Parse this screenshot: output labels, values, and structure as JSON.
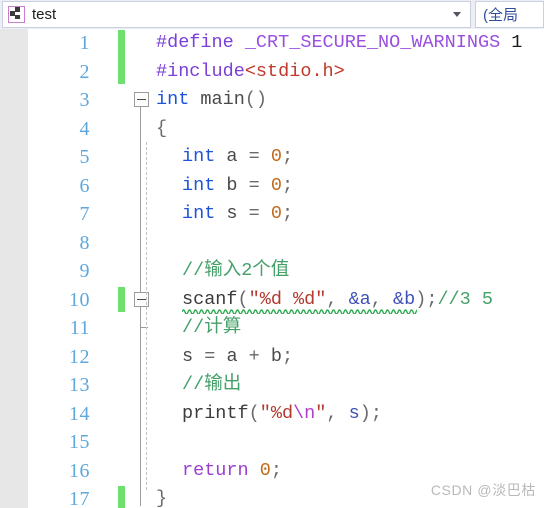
{
  "window": {
    "navbar": {
      "project_icon": "cpp-project-icon",
      "project_name": "test",
      "scope_dropdown_arrow": "chevron-down-icon",
      "member_value": "(全局"
    }
  },
  "editor": {
    "gutter": {
      "line_numbers": [
        "1",
        "2",
        "3",
        "4",
        "5",
        "6",
        "7",
        "8",
        "9",
        "10",
        "11",
        "12",
        "13",
        "14",
        "15",
        "16",
        "17"
      ]
    },
    "change_bar_lines": [
      1,
      2,
      10,
      17
    ],
    "collapse_toggle_lines": [
      3,
      10
    ],
    "collapse_icon": "minus-box-icon",
    "lines": [
      {
        "n": "1",
        "indent": 0,
        "tokens": [
          {
            "t": "#define ",
            "c": "k-pre"
          },
          {
            "t": "_CRT_SECURE_NO_WARNINGS",
            "c": "k-macro"
          },
          {
            "t": " 1",
            "c": "k-num"
          }
        ]
      },
      {
        "n": "2",
        "indent": 0,
        "tokens": [
          {
            "t": "#include",
            "c": "k-pre"
          },
          {
            "t": "<stdio.h>",
            "c": "k-inc"
          }
        ]
      },
      {
        "n": "3",
        "indent": 0,
        "tokens": [
          {
            "t": "int",
            "c": "k-kw"
          },
          {
            "t": " main",
            "c": "k-id"
          },
          {
            "t": "()",
            "c": "k-punc"
          }
        ]
      },
      {
        "n": "4",
        "indent": 0,
        "tokens": [
          {
            "t": "{",
            "c": "k-punc"
          }
        ]
      },
      {
        "n": "5",
        "indent": 1,
        "tokens": [
          {
            "t": "int",
            "c": "k-kw"
          },
          {
            "t": " a ",
            "c": "k-id"
          },
          {
            "t": "= ",
            "c": "k-punc"
          },
          {
            "t": "0",
            "c": "k-zero"
          },
          {
            "t": ";",
            "c": "k-punc"
          }
        ]
      },
      {
        "n": "6",
        "indent": 1,
        "tokens": [
          {
            "t": "int",
            "c": "k-kw"
          },
          {
            "t": " b ",
            "c": "k-id"
          },
          {
            "t": "= ",
            "c": "k-punc"
          },
          {
            "t": "0",
            "c": "k-zero"
          },
          {
            "t": ";",
            "c": "k-punc"
          }
        ]
      },
      {
        "n": "7",
        "indent": 1,
        "tokens": [
          {
            "t": "int",
            "c": "k-kw"
          },
          {
            "t": " s ",
            "c": "k-id"
          },
          {
            "t": "= ",
            "c": "k-punc"
          },
          {
            "t": "0",
            "c": "k-zero"
          },
          {
            "t": ";",
            "c": "k-punc"
          }
        ]
      },
      {
        "n": "8",
        "indent": 1,
        "tokens": []
      },
      {
        "n": "9",
        "indent": 1,
        "tokens": [
          {
            "t": "//输入2个值",
            "c": "k-cmt"
          }
        ]
      },
      {
        "n": "10",
        "indent": 1,
        "tokens": [
          {
            "t": "scanf",
            "c": "k-fn"
          },
          {
            "t": "(",
            "c": "k-punc"
          },
          {
            "t": "\"%d %d\"",
            "c": "k-str"
          },
          {
            "t": ", ",
            "c": "k-punc"
          },
          {
            "t": "&a",
            "c": "k-var"
          },
          {
            "t": ", ",
            "c": "k-punc"
          },
          {
            "t": "&b",
            "c": "k-var"
          },
          {
            "t": ")",
            "c": "k-punc"
          },
          {
            "t": ";",
            "c": "k-punc"
          },
          {
            "t": "//3 5",
            "c": "k-cmt"
          }
        ]
      },
      {
        "n": "11",
        "indent": 1,
        "tokens": [
          {
            "t": "//计算",
            "c": "k-cmt"
          }
        ]
      },
      {
        "n": "12",
        "indent": 1,
        "tokens": [
          {
            "t": "s ",
            "c": "k-id"
          },
          {
            "t": "= ",
            "c": "k-punc"
          },
          {
            "t": "a ",
            "c": "k-id"
          },
          {
            "t": "+ ",
            "c": "k-punc"
          },
          {
            "t": "b",
            "c": "k-id"
          },
          {
            "t": ";",
            "c": "k-punc"
          }
        ]
      },
      {
        "n": "13",
        "indent": 1,
        "tokens": [
          {
            "t": "//输出",
            "c": "k-cmt"
          }
        ]
      },
      {
        "n": "14",
        "indent": 1,
        "tokens": [
          {
            "t": "printf",
            "c": "k-fn"
          },
          {
            "t": "(",
            "c": "k-punc"
          },
          {
            "t": "\"%d",
            "c": "k-str"
          },
          {
            "t": "\\n",
            "c": "k-esc"
          },
          {
            "t": "\"",
            "c": "k-str"
          },
          {
            "t": ", ",
            "c": "k-punc"
          },
          {
            "t": "s",
            "c": "k-var"
          },
          {
            "t": ")",
            "c": "k-punc"
          },
          {
            "t": ";",
            "c": "k-punc"
          }
        ]
      },
      {
        "n": "15",
        "indent": 1,
        "tokens": []
      },
      {
        "n": "16",
        "indent": 1,
        "tokens": [
          {
            "t": "return",
            "c": "k-ret"
          },
          {
            "t": " ",
            "c": "k-id"
          },
          {
            "t": "0",
            "c": "k-zero"
          },
          {
            "t": ";",
            "c": "k-punc"
          }
        ]
      },
      {
        "n": "17",
        "indent": 0,
        "tokens": [
          {
            "t": "}",
            "c": "k-punc"
          }
        ]
      }
    ],
    "error_squiggle": {
      "line": 10,
      "label": "scanf-deprecated-squiggle"
    }
  },
  "watermark": {
    "text": "CSDN @淡巴枯"
  },
  "colors": {
    "change_bar": "#6fe06f",
    "line_number": "#5fa8dd",
    "comment": "#45a06a",
    "string": "#b33a2e",
    "keyword": "#1f54d8",
    "macro": "#9a4fe0",
    "squiggle": "#33aa55",
    "navbar_bg": "#eceef5"
  }
}
